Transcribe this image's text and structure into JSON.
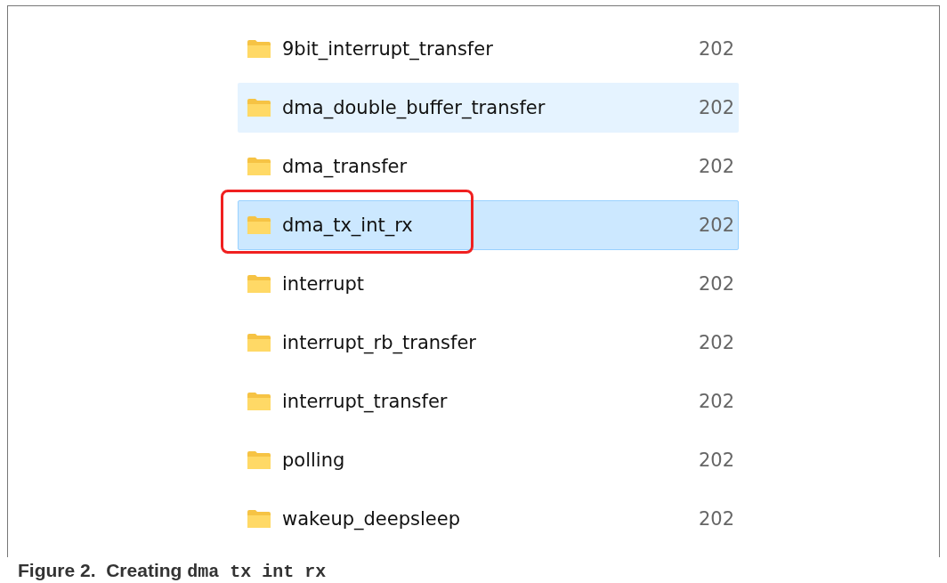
{
  "file_list": {
    "rows": [
      {
        "name": "9bit_interrupt_transfer",
        "date": "202",
        "hovered": false,
        "selected": false,
        "annotated": false
      },
      {
        "name": "dma_double_buffer_transfer",
        "date": "202",
        "hovered": true,
        "selected": false,
        "annotated": false
      },
      {
        "name": "dma_transfer",
        "date": "202",
        "hovered": false,
        "selected": false,
        "annotated": false
      },
      {
        "name": "dma_tx_int_rx",
        "date": "202",
        "hovered": false,
        "selected": true,
        "annotated": true
      },
      {
        "name": "interrupt",
        "date": "202",
        "hovered": false,
        "selected": false,
        "annotated": false
      },
      {
        "name": "interrupt_rb_transfer",
        "date": "202",
        "hovered": false,
        "selected": false,
        "annotated": false
      },
      {
        "name": "interrupt_transfer",
        "date": "202",
        "hovered": false,
        "selected": false,
        "annotated": false
      },
      {
        "name": "polling",
        "date": "202",
        "hovered": false,
        "selected": false,
        "annotated": false
      },
      {
        "name": "wakeup_deepsleep",
        "date": "202",
        "hovered": false,
        "selected": false,
        "annotated": false
      }
    ]
  },
  "caption": {
    "label": "Figure 2.",
    "text": "Creating",
    "code": "dma tx int rx"
  }
}
